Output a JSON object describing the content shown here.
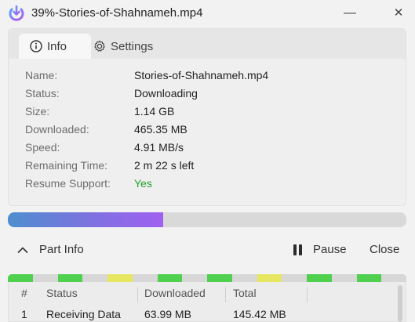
{
  "window": {
    "title": "39%-Stories-of-Shahnameh.mp4",
    "minimize_symbol": "—",
    "close_symbol": "✕"
  },
  "tabs": [
    {
      "label": "Info",
      "icon": "info-icon",
      "active": true
    },
    {
      "label": "Settings",
      "icon": "gear-icon",
      "active": false
    }
  ],
  "info": [
    {
      "label": "Name:",
      "value": "Stories-of-Shahnameh.mp4"
    },
    {
      "label": "Status:",
      "value": "Downloading"
    },
    {
      "label": "Size:",
      "value": "1.14 GB"
    },
    {
      "label": "Downloaded:",
      "value": "465.35 MB"
    },
    {
      "label": "Speed:",
      "value": "4.91 MB/s"
    },
    {
      "label": "Remaining Time:",
      "value": "2 m 22 s left"
    },
    {
      "label": "Resume Support:",
      "value": "Yes"
    }
  ],
  "progress": {
    "fraction": 0.39,
    "colors": [
      "#4d8fcf",
      "#a060f0"
    ]
  },
  "part_bar": {
    "toggle_label": "Part Info",
    "pause_label": "Pause",
    "close_label": "Close"
  },
  "segments": {
    "colors": {
      "done": "#4fd14f",
      "active": "#e6e661",
      "idle": "#d7d7d7"
    },
    "states": [
      "done",
      "idle",
      "done",
      "idle",
      "active",
      "idle",
      "done",
      "idle",
      "done",
      "idle",
      "active",
      "idle",
      "done",
      "idle",
      "done",
      "idle"
    ]
  },
  "parts_table": {
    "columns": [
      "#",
      "Status",
      "Downloaded",
      "Total"
    ],
    "rows": [
      [
        "1",
        "Receiving Data",
        "63.99 MB",
        "145.42 MB"
      ]
    ]
  }
}
